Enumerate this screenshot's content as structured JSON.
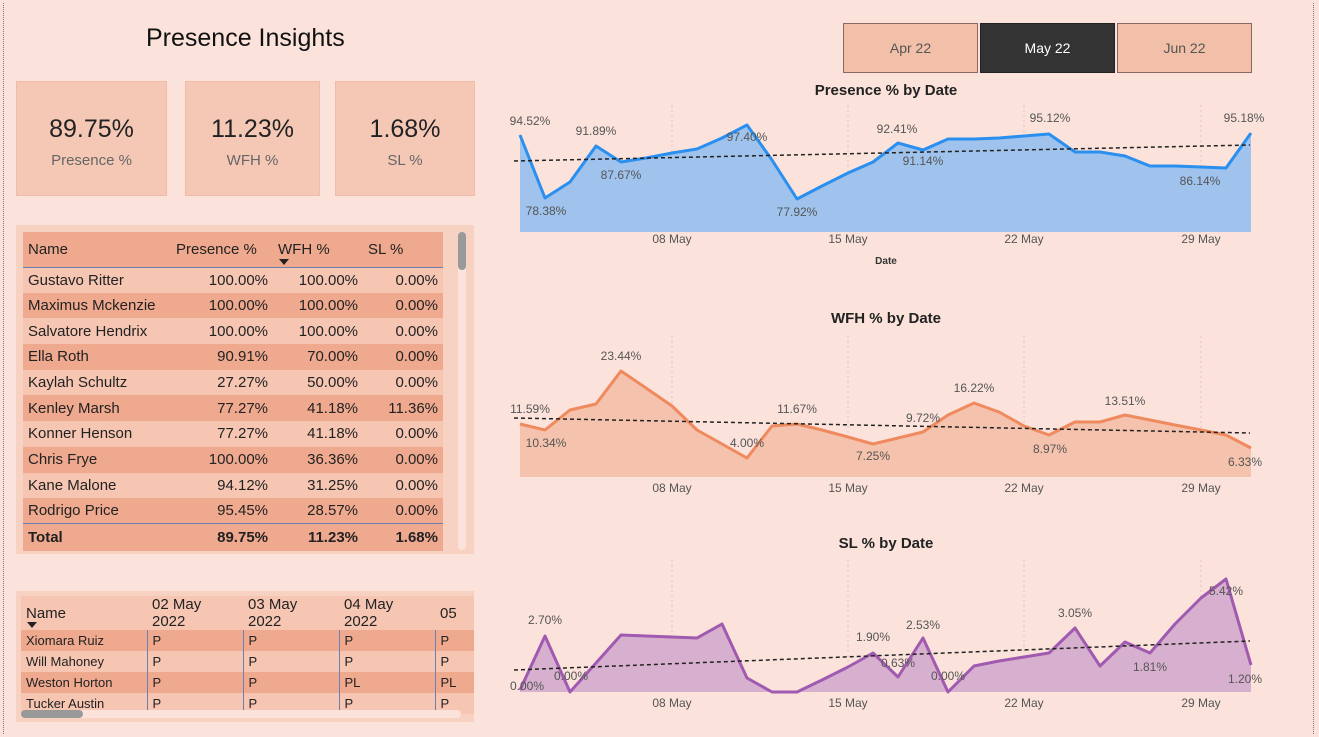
{
  "title": "Presence Insights",
  "kpis": [
    {
      "value": "89.75%",
      "label": "Presence %"
    },
    {
      "value": "11.23%",
      "label": "WFH %"
    },
    {
      "value": "1.68%",
      "label": "SL %"
    }
  ],
  "slicers": [
    {
      "label": "Apr 22",
      "active": false
    },
    {
      "label": "May 22",
      "active": true
    },
    {
      "label": "Jun 22",
      "active": false
    }
  ],
  "table": {
    "headers": [
      "Name",
      "Presence %",
      "WFH %",
      "SL %"
    ],
    "rows": [
      [
        "Gustavo Ritter",
        "100.00%",
        "100.00%",
        "0.00%"
      ],
      [
        "Maximus Mckenzie",
        "100.00%",
        "100.00%",
        "0.00%"
      ],
      [
        "Salvatore Hendrix",
        "100.00%",
        "100.00%",
        "0.00%"
      ],
      [
        "Ella Roth",
        "90.91%",
        "70.00%",
        "0.00%"
      ],
      [
        "Kaylah Schultz",
        "27.27%",
        "50.00%",
        "0.00%"
      ],
      [
        "Kenley Marsh",
        "77.27%",
        "41.18%",
        "11.36%"
      ],
      [
        "Konner Henson",
        "77.27%",
        "41.18%",
        "0.00%"
      ],
      [
        "Chris Frye",
        "100.00%",
        "36.36%",
        "0.00%"
      ],
      [
        "Kane Malone",
        "94.12%",
        "31.25%",
        "0.00%"
      ],
      [
        "Rodrigo Price",
        "95.45%",
        "28.57%",
        "0.00%"
      ]
    ],
    "total": [
      "Total",
      "89.75%",
      "11.23%",
      "1.68%"
    ]
  },
  "matrix": {
    "headers": [
      "Name",
      "02 May 2022",
      "03 May 2022",
      "04 May 2022",
      "05"
    ],
    "rows": [
      [
        "Xiomara Ruiz",
        "P",
        "P",
        "P",
        "P"
      ],
      [
        "Will Mahoney",
        "P",
        "P",
        "P",
        "P"
      ],
      [
        "Weston Horton",
        "P",
        "P",
        "PL",
        "PL"
      ],
      [
        "Tucker Austin",
        "P",
        "P",
        "P",
        "P"
      ]
    ]
  },
  "chart_data": [
    {
      "type": "area",
      "title": "Presence % by Date",
      "xlabel": "Date",
      "ylabel": "",
      "x_ticks": [
        "08 May",
        "15 May",
        "22 May",
        "29 May"
      ],
      "x": [
        1,
        2,
        3,
        4,
        5,
        6,
        8,
        9,
        10,
        11,
        12,
        13,
        14,
        15,
        16,
        17,
        18,
        19,
        20,
        22,
        23,
        24,
        25,
        26,
        27,
        30,
        31
      ],
      "y": [
        94.52,
        78.38,
        80.5,
        91.89,
        87.67,
        88.5,
        90.2,
        92.5,
        97.4,
        90.0,
        77.92,
        82.0,
        86.0,
        87.8,
        92.41,
        91.14,
        93.2,
        93.2,
        93.4,
        95.0,
        95.12,
        90.9,
        90.9,
        89.8,
        88.0,
        87.6,
        86.14
      ],
      "y_last": 95.18,
      "labels": [
        "94.52%",
        "78.38%",
        "91.89%",
        "87.67%",
        "97.40%",
        "77.92%",
        "92.41%",
        "91.14%",
        "95.12%",
        "86.14%",
        "95.18%"
      ],
      "trendline": true,
      "color": "#2b8ff0",
      "fill": "#9fc3ec"
    },
    {
      "type": "area",
      "title": "WFH % by Date",
      "xlabel": "",
      "ylabel": "",
      "x_ticks": [
        "08 May",
        "15 May",
        "22 May",
        "29 May"
      ],
      "labels": [
        "11.59%",
        "10.34%",
        "23.44%",
        "11.67%",
        "4.00%",
        "7.25%",
        "9.72%",
        "16.22%",
        "8.97%",
        "13.51%",
        "6.33%"
      ],
      "trendline": true,
      "color": "#ef8a5f",
      "fill": "#f5c3ad"
    },
    {
      "type": "area",
      "title": "SL % by Date",
      "xlabel": "",
      "ylabel": "",
      "x_ticks": [
        "08 May",
        "15 May",
        "22 May",
        "29 May"
      ],
      "labels": [
        "2.70%",
        "0.00%",
        "0.00%",
        "1.90%",
        "0.63%",
        "2.53%",
        "0.00%",
        "3.05%",
        "1.81%",
        "5.42%",
        "1.20%"
      ],
      "trendline": true,
      "color": "#a05ab0",
      "fill": "#d8b0cf"
    }
  ]
}
